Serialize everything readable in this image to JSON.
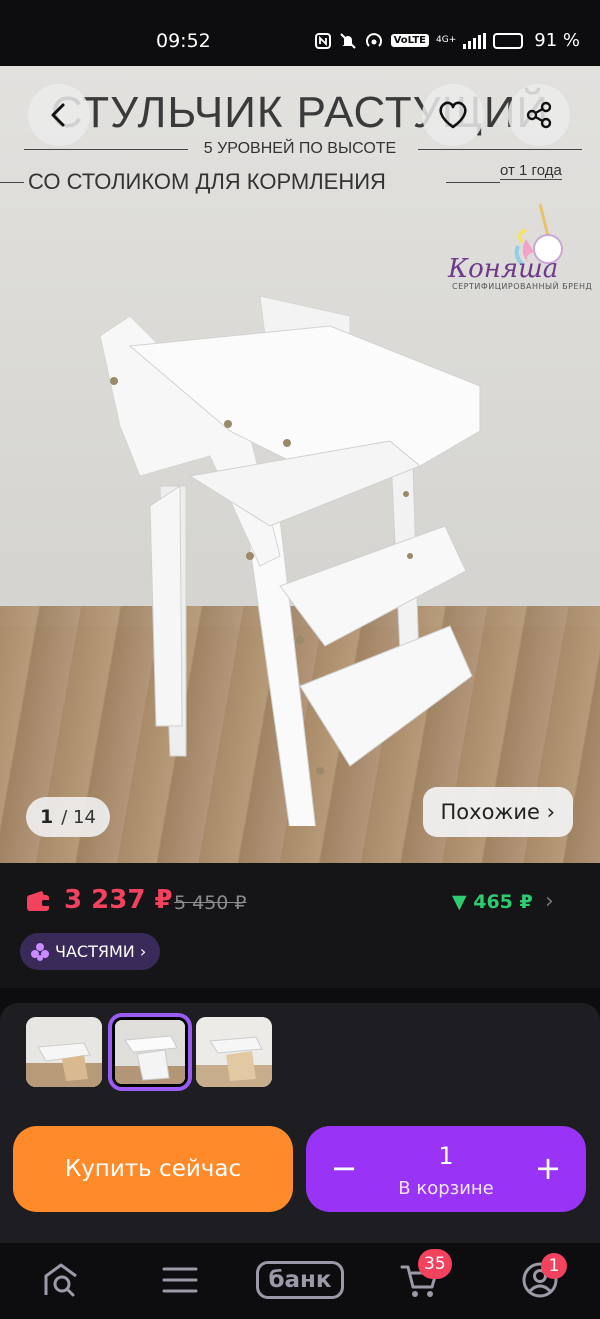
{
  "status_bar": {
    "time": "09:52",
    "volte": "VoLTE",
    "network": "4G+",
    "battery_percent": "91 %",
    "battery_level": 0.91
  },
  "hero": {
    "title": "СТУЛЬЧИК РАСТУЩИЙ",
    "subtitle1": "5 УРОВНЕЙ ПО ВЫСОТЕ",
    "subtitle2": "СО СТОЛИКОМ ДЛЯ КОРМЛЕНИЯ",
    "age": "от 1 года",
    "brand_name": "Коняша",
    "brand_tagline": "СЕРТИФИЦИРОВАННЫЙ БРЕНД",
    "counter_current": "1",
    "counter_total": "/ 14",
    "similar_label": "Похожие ›"
  },
  "icons": {
    "back": "chevron-left-icon",
    "favorite": "heart-icon",
    "share": "share-icon",
    "wallet": "wallet-icon",
    "parts": "parts-icon",
    "home": "home-search-icon",
    "catalog": "menu-icon",
    "cart": "cart-icon",
    "profile": "profile-icon"
  },
  "price": {
    "current": "3 237 ₽",
    "old": "5 450 ₽",
    "drop": "▼ 465 ₽",
    "chevron": "›",
    "parts_label": "ЧАСТЯМИ ›"
  },
  "actions": {
    "buy_now": "Купить сейчас",
    "quantity": "1",
    "in_cart": "В корзине",
    "minus": "−",
    "plus": "+"
  },
  "tabbar": {
    "bank_label": "банк",
    "cart_badge": "35",
    "profile_badge": "1"
  },
  "colors": {
    "accent_purple": "#9933f5",
    "buy_orange": "#ff8a2a",
    "price_red": "#f2425e",
    "drop_green": "#2ecc71"
  }
}
